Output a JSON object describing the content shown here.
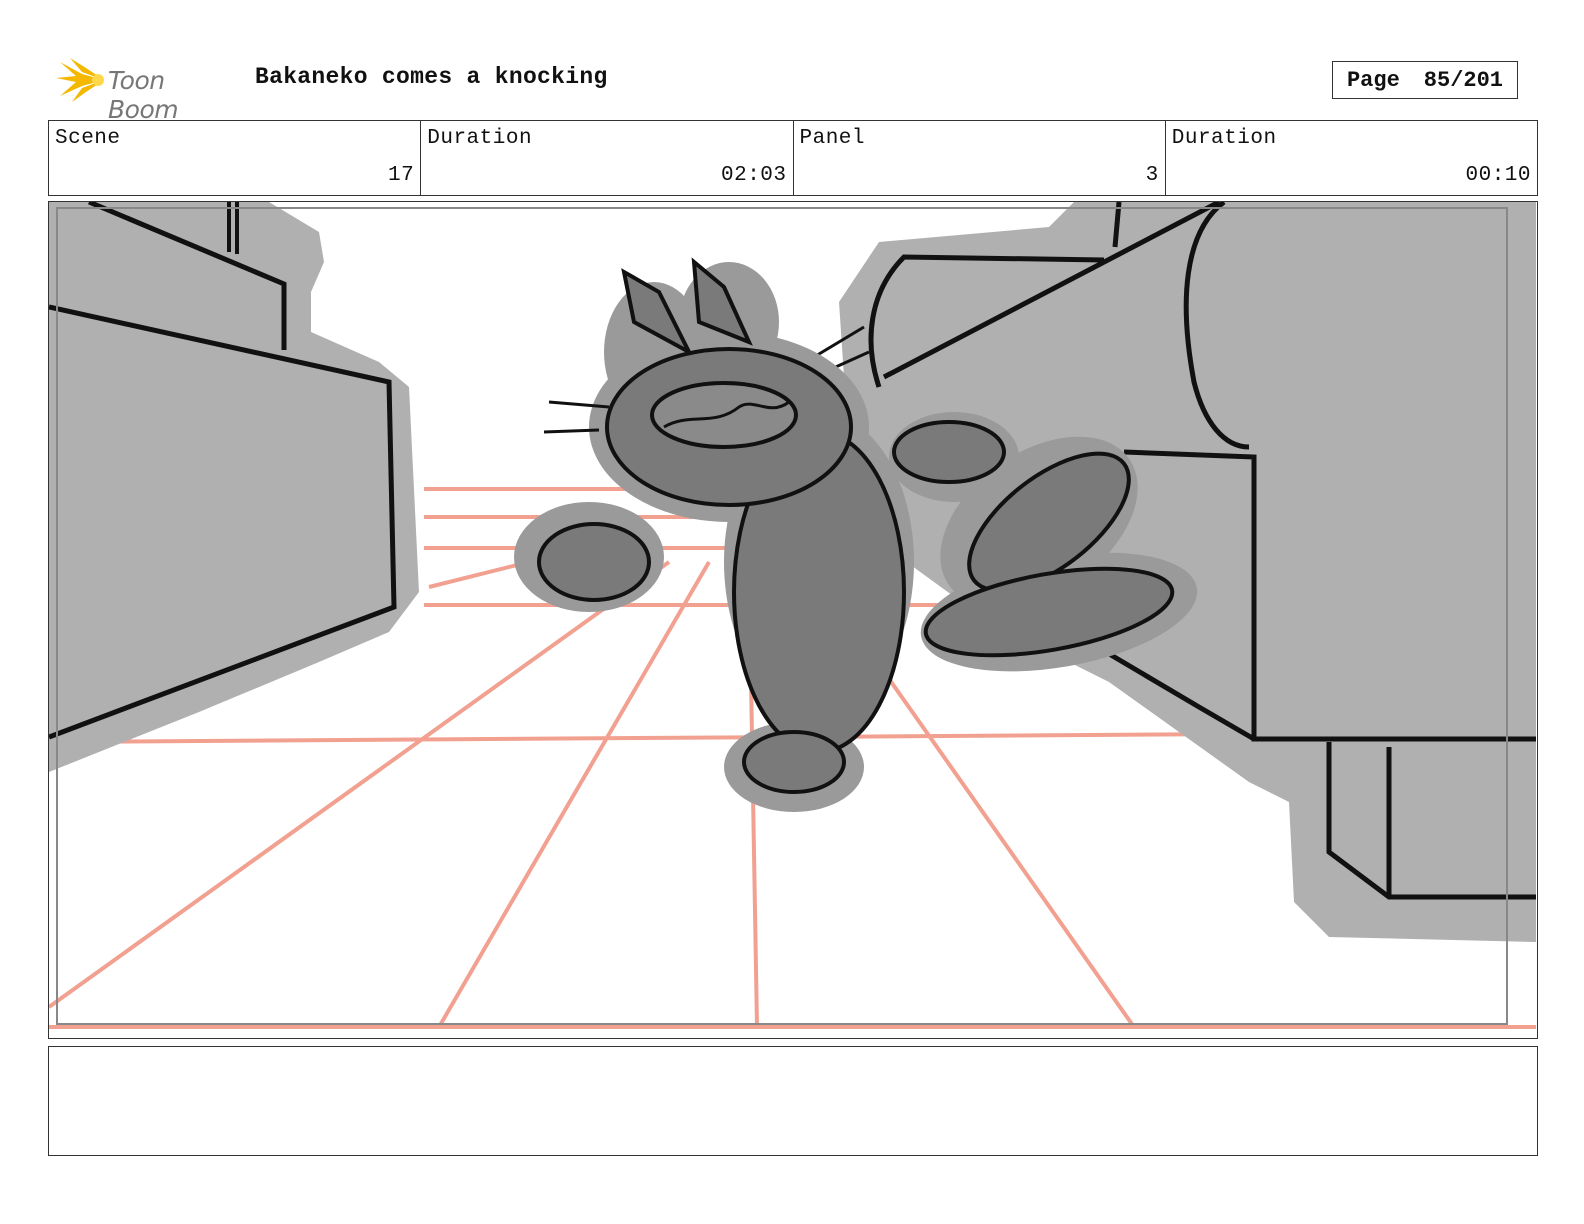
{
  "header": {
    "logo_text": "Toon Boom",
    "title": "Bakaneko comes a knocking",
    "page_label": "Page",
    "page_value": "85/201"
  },
  "info": {
    "scene_label": "Scene",
    "scene_value": "17",
    "scene_duration_label": "Duration",
    "scene_duration_value": "02:03",
    "panel_label": "Panel",
    "panel_value": "3",
    "panel_duration_label": "Duration",
    "panel_duration_value": "00:10"
  },
  "colors": {
    "logo_star": "#f5b800",
    "floor_grid": "#f2a090",
    "furniture_fill": "#b0b0b0",
    "cat_fill": "#7a7a7a",
    "cat_halo": "#9a9a9a"
  },
  "notes": {
    "text": ""
  }
}
